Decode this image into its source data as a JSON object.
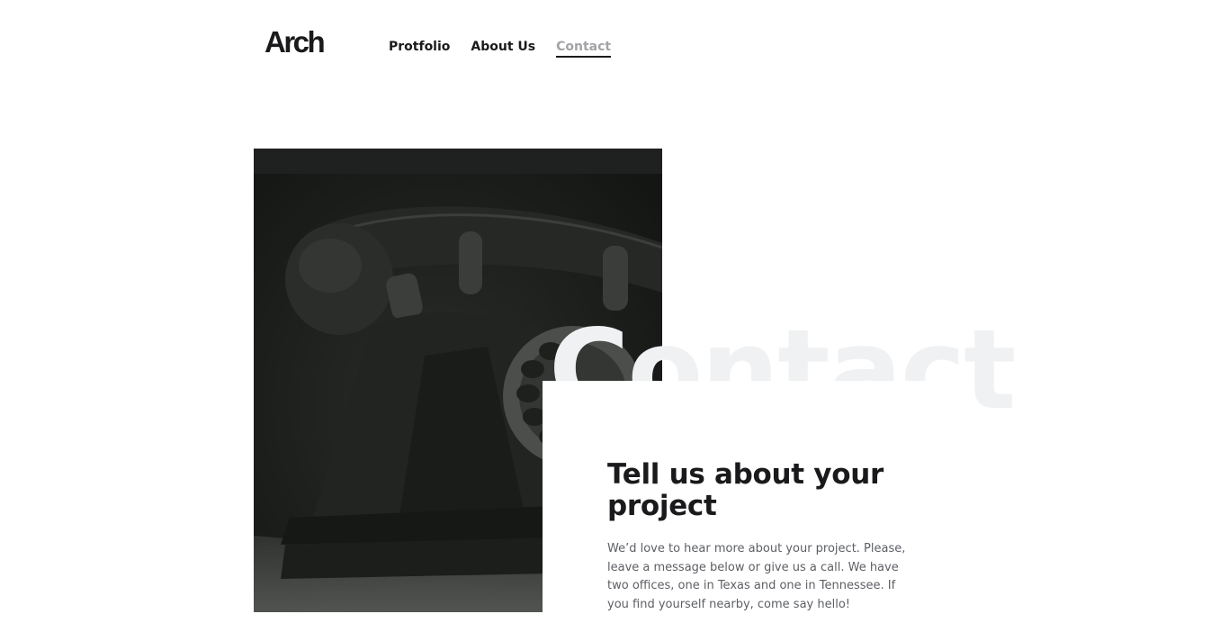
{
  "header": {
    "logo": "Arch",
    "nav": [
      {
        "label": "Protfolio",
        "active": false
      },
      {
        "label": "About Us",
        "active": false
      },
      {
        "label": "Contact",
        "active": true
      }
    ]
  },
  "hero": {
    "image_description": "vintage-rotary-telephone-photo",
    "big_word": "Contact"
  },
  "content": {
    "title": "Tell us about your project",
    "body": "We’d love to hear more about your project. Please, leave a message below or give us a call. We have two offices, one in Texas and one in Tennessee. If you find yourself nearby, come say hello!"
  },
  "colors": {
    "text": "#1a1a1c",
    "nav_active": "#a3a3a8",
    "body_text": "#5d5f64",
    "big_word": "#f0f1f3",
    "photo_bg": "#1b1d1b"
  }
}
